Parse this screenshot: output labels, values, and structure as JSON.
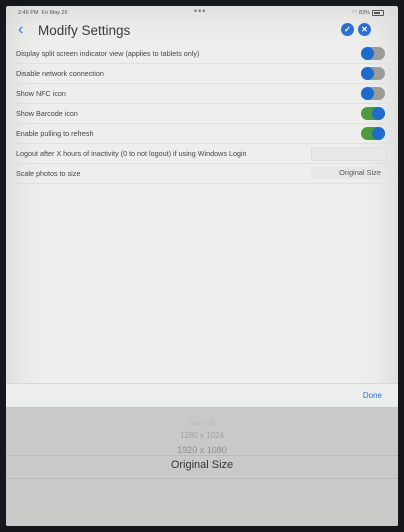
{
  "status": {
    "time": "2:46 PM",
    "date": "Fri May 26",
    "battery": "83%"
  },
  "header": {
    "title": "Modify Settings"
  },
  "settings": [
    {
      "label": "Display split screen indicator view (applies to tablets only)",
      "type": "toggle",
      "on": false
    },
    {
      "label": "Disable network connection",
      "type": "toggle",
      "on": false
    },
    {
      "label": "Show NFC icon",
      "type": "toggle",
      "on": false
    },
    {
      "label": "Show Barcode icon",
      "type": "toggle",
      "on": true
    },
    {
      "label": "Enable pulling to refresh",
      "type": "toggle",
      "on": true
    },
    {
      "label": "Logout after X hours of inactivity (0 to not logout) if using Windows Login",
      "type": "text",
      "value": ""
    },
    {
      "label": "Scale photos to size",
      "type": "select",
      "value": "Original Size"
    }
  ],
  "toolbar": {
    "done_label": "Done"
  },
  "picker": {
    "options": [
      "1024 x 768",
      "1280 x 1024",
      "1920 x 1080",
      "Original Size"
    ],
    "selected": "Original Size"
  },
  "colors": {
    "accent": "#2f6fd0",
    "toggle_on": "#4e9b3d",
    "toggle_off": "#9a9c9a"
  }
}
